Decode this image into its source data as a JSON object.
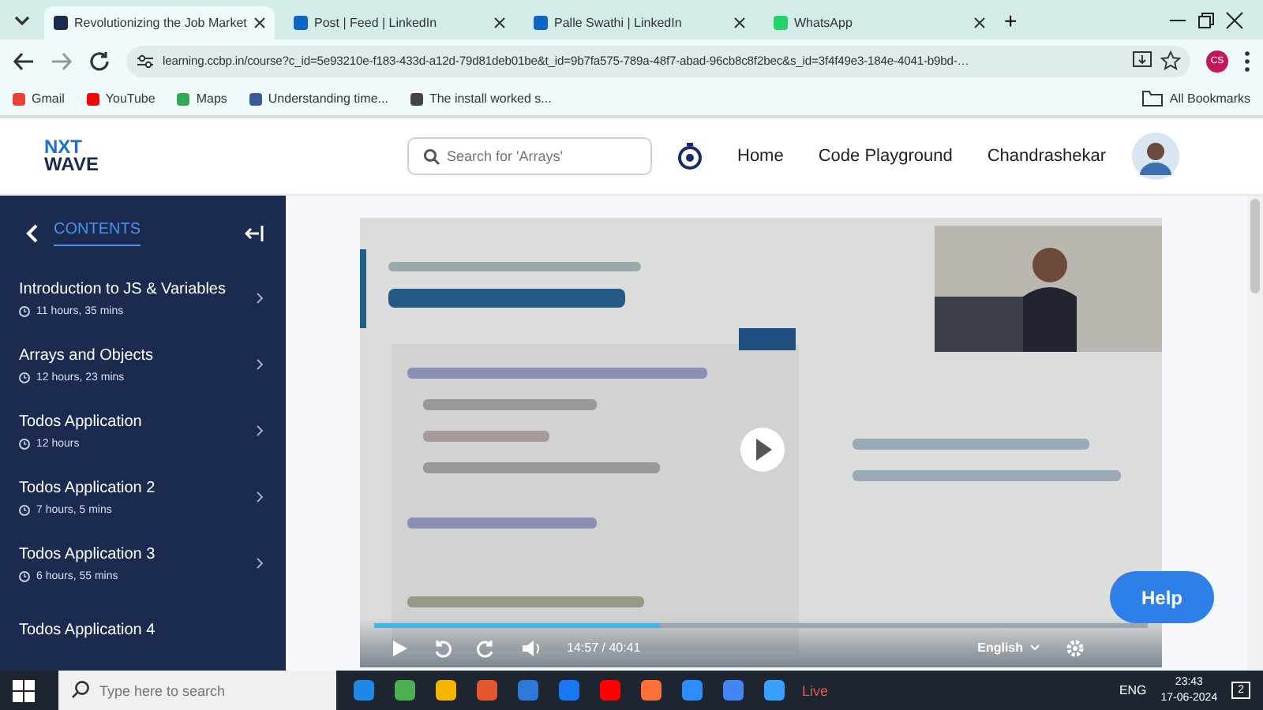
{
  "browser": {
    "tabs": [
      {
        "title": "Revolutionizing the Job Market",
        "selected": true
      },
      {
        "title": "Post | Feed | LinkedIn",
        "selected": false
      },
      {
        "title": "Palle Swathi | LinkedIn",
        "selected": false
      },
      {
        "title": "WhatsApp",
        "selected": false
      }
    ],
    "new_tab": "+",
    "url": "learning.ccbp.in/course?c_id=5e93210e-f183-433d-a12d-79d81deb01be&t_id=9b7fa575-789a-48f7-abad-96cb8c8f2bec&s_id=3f4f49e3-184e-4041-b9bd-…",
    "profile": "CS",
    "bookmarks": [
      "Gmail",
      "YouTube",
      "Maps",
      "Understanding time...",
      "The install worked s..."
    ],
    "all_bookmarks": "All Bookmarks"
  },
  "header": {
    "logo_top": "NXT",
    "logo_bottom": "WAVE",
    "search": {
      "placeholder": "Search for 'Arrays'"
    },
    "nav": [
      "Home",
      "Code Playground"
    ],
    "user": "Chandrashekar"
  },
  "sidebar": {
    "title": "CONTENTS",
    "items": [
      {
        "title": "Introduction to JS & Variables",
        "duration": "11 hours, 35 mins"
      },
      {
        "title": "Arrays and Objects",
        "duration": "12 hours, 23 mins"
      },
      {
        "title": "Todos Application",
        "duration": "12 hours"
      },
      {
        "title": "Todos Application 2",
        "duration": "7 hours, 5 mins"
      },
      {
        "title": "Todos Application 3",
        "duration": "6 hours, 55 mins"
      },
      {
        "title": "Todos Application 4"
      }
    ]
  },
  "player": {
    "progress": {
      "level": 0.37
    },
    "time": "14:57 / 40:41",
    "language": "English"
  },
  "help": "Help",
  "taskbar": {
    "search": {
      "placeholder": "Type here to search"
    },
    "live": "Live",
    "lang": "ENG",
    "time": "23:43",
    "date": "17-06-2024",
    "notifications": "2"
  }
}
